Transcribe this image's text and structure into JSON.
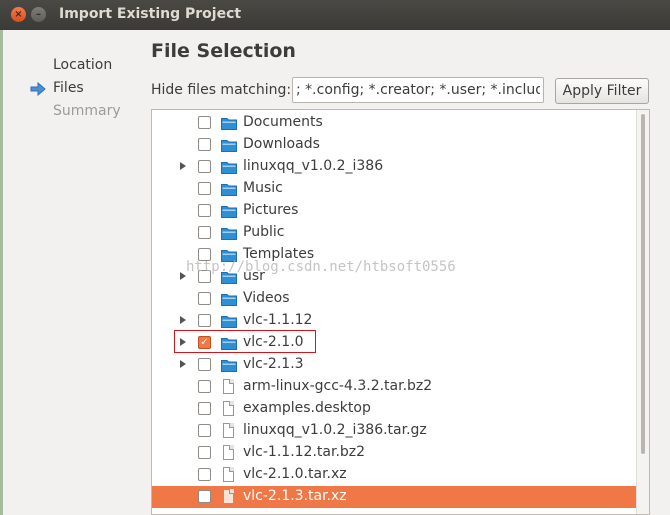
{
  "window": {
    "title": "Import Existing Project",
    "close_symbol": "×",
    "min_symbol": "–"
  },
  "nav": {
    "location": "Location",
    "files": "Files",
    "summary": "Summary",
    "current_icon": "arrow-right-icon"
  },
  "main": {
    "heading": "File Selection",
    "hide_label": "Hide files matching:",
    "filter_value": "; *.config; *.creator; *.user; *.includes",
    "apply_button": "Apply Filter"
  },
  "tree": {
    "rows": [
      {
        "name": "Documents",
        "type": "folder",
        "expandable": false,
        "checked": false
      },
      {
        "name": "Downloads",
        "type": "folder",
        "expandable": false,
        "checked": false
      },
      {
        "name": "linuxqq_v1.0.2_i386",
        "type": "folder",
        "expandable": true,
        "checked": false
      },
      {
        "name": "Music",
        "type": "folder",
        "expandable": false,
        "checked": false
      },
      {
        "name": "Pictures",
        "type": "folder",
        "expandable": false,
        "checked": false
      },
      {
        "name": "Public",
        "type": "folder",
        "expandable": false,
        "checked": false
      },
      {
        "name": "Templates",
        "type": "folder",
        "expandable": false,
        "checked": false
      },
      {
        "name": "usr",
        "type": "folder",
        "expandable": true,
        "checked": false
      },
      {
        "name": "Videos",
        "type": "folder",
        "expandable": false,
        "checked": false
      },
      {
        "name": "vlc-1.1.12",
        "type": "folder",
        "expandable": true,
        "checked": false
      },
      {
        "name": "vlc-2.1.0",
        "type": "folder",
        "expandable": true,
        "checked": true
      },
      {
        "name": "vlc-2.1.3",
        "type": "folder",
        "expandable": true,
        "checked": false
      },
      {
        "name": "arm-linux-gcc-4.3.2.tar.bz2",
        "type": "file",
        "expandable": false,
        "checked": false
      },
      {
        "name": "examples.desktop",
        "type": "file",
        "expandable": false,
        "checked": false
      },
      {
        "name": "linuxqq_v1.0.2_i386.tar.gz",
        "type": "file",
        "expandable": false,
        "checked": false
      },
      {
        "name": "vlc-1.1.12.tar.bz2",
        "type": "file",
        "expandable": false,
        "checked": false
      },
      {
        "name": "vlc-2.1.0.tar.xz",
        "type": "file",
        "expandable": false,
        "checked": false
      },
      {
        "name": "vlc-2.1.3.tar.xz",
        "type": "file",
        "expandable": false,
        "checked": false,
        "selected": true
      }
    ]
  },
  "watermark": "http://blog.csdn.net/htbsoft0556",
  "colors": {
    "accent": "#f07746",
    "folder": "#2f8fd5",
    "highlight_box": "#d2141b"
  }
}
